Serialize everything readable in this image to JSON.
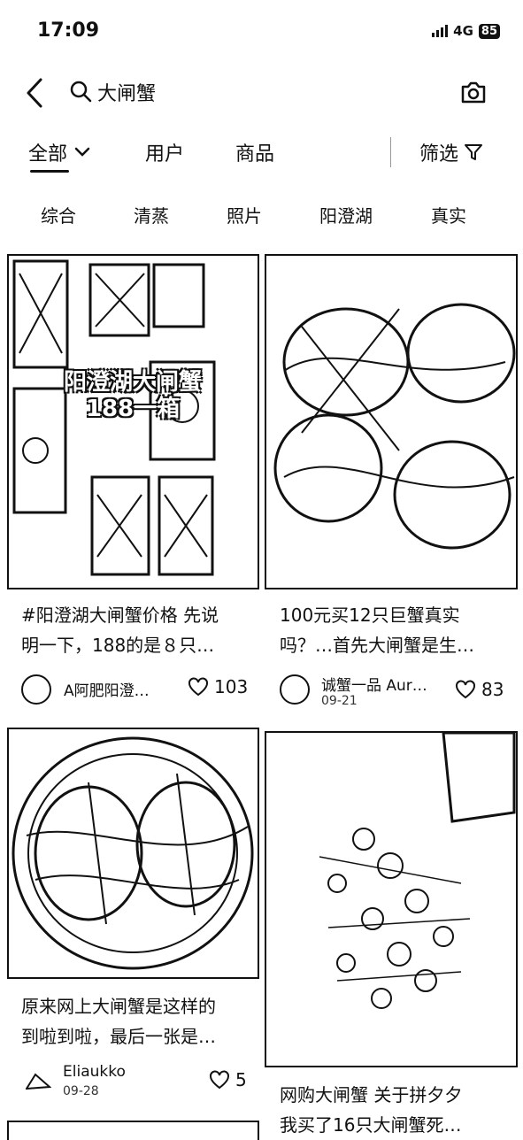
{
  "status": {
    "time": "17:09",
    "network": "4G",
    "battery": "85"
  },
  "search": {
    "query": "大闸蟹"
  },
  "tabs": [
    {
      "label": "全部"
    },
    {
      "label": "用户"
    },
    {
      "label": "商品"
    }
  ],
  "filter_label": "筛选",
  "chips": [
    "综合",
    "清蒸",
    "照片",
    "阳澄湖",
    "真实"
  ],
  "cards": [
    {
      "overlay": "阳澄湖大闸蟹\n188一箱",
      "title_line1": "#阳澄湖大闸蟹价格 先说",
      "title_line2": "明一下，188的是８只…",
      "author": "A阿肥阳澄…",
      "date": "",
      "likes": "103"
    },
    {
      "overlay": "",
      "title_line1": "100元买12只巨蟹真实",
      "title_line2": "吗？…首先大闸蟹是生…",
      "author": "诚蟹一品 Aur…",
      "date": "09-21",
      "likes": "83"
    },
    {
      "overlay": "",
      "title_line1": "原来网上大闸蟹是这样的",
      "title_line2": "到啦到啦，最后一张是…",
      "author": "Eliaukko",
      "date": "09-28",
      "likes": "5"
    },
    {
      "overlay": "",
      "title_line1": "网购大闸蟹 关于拼夕夕",
      "title_line2": "我买了16只大闸蟹死…",
      "author": "",
      "date": "",
      "likes": ""
    }
  ]
}
